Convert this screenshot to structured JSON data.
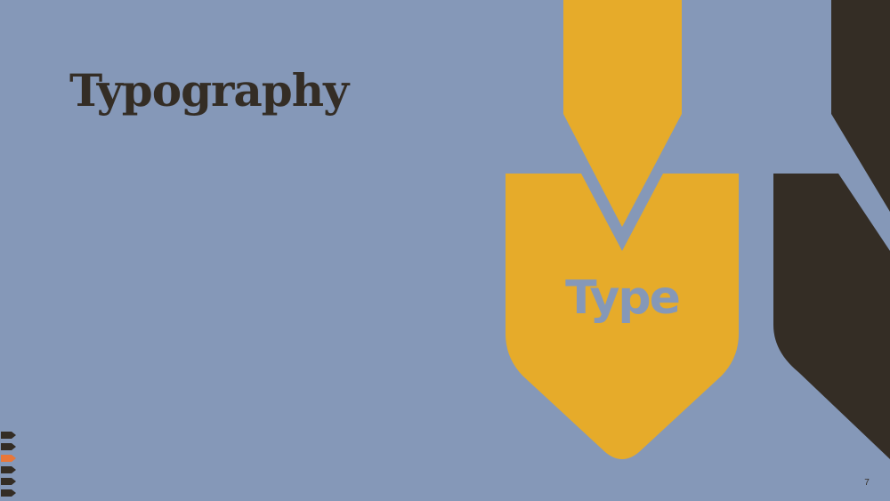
{
  "slide": {
    "title": "Typography",
    "shape_text": "Type",
    "page_number": "7"
  },
  "colors": {
    "background": "#8598b8",
    "mustard": "#e6ab2a",
    "dark_brown": "#342d25",
    "accent": "#e8773a"
  },
  "nav": {
    "count": 6,
    "current": 3
  }
}
